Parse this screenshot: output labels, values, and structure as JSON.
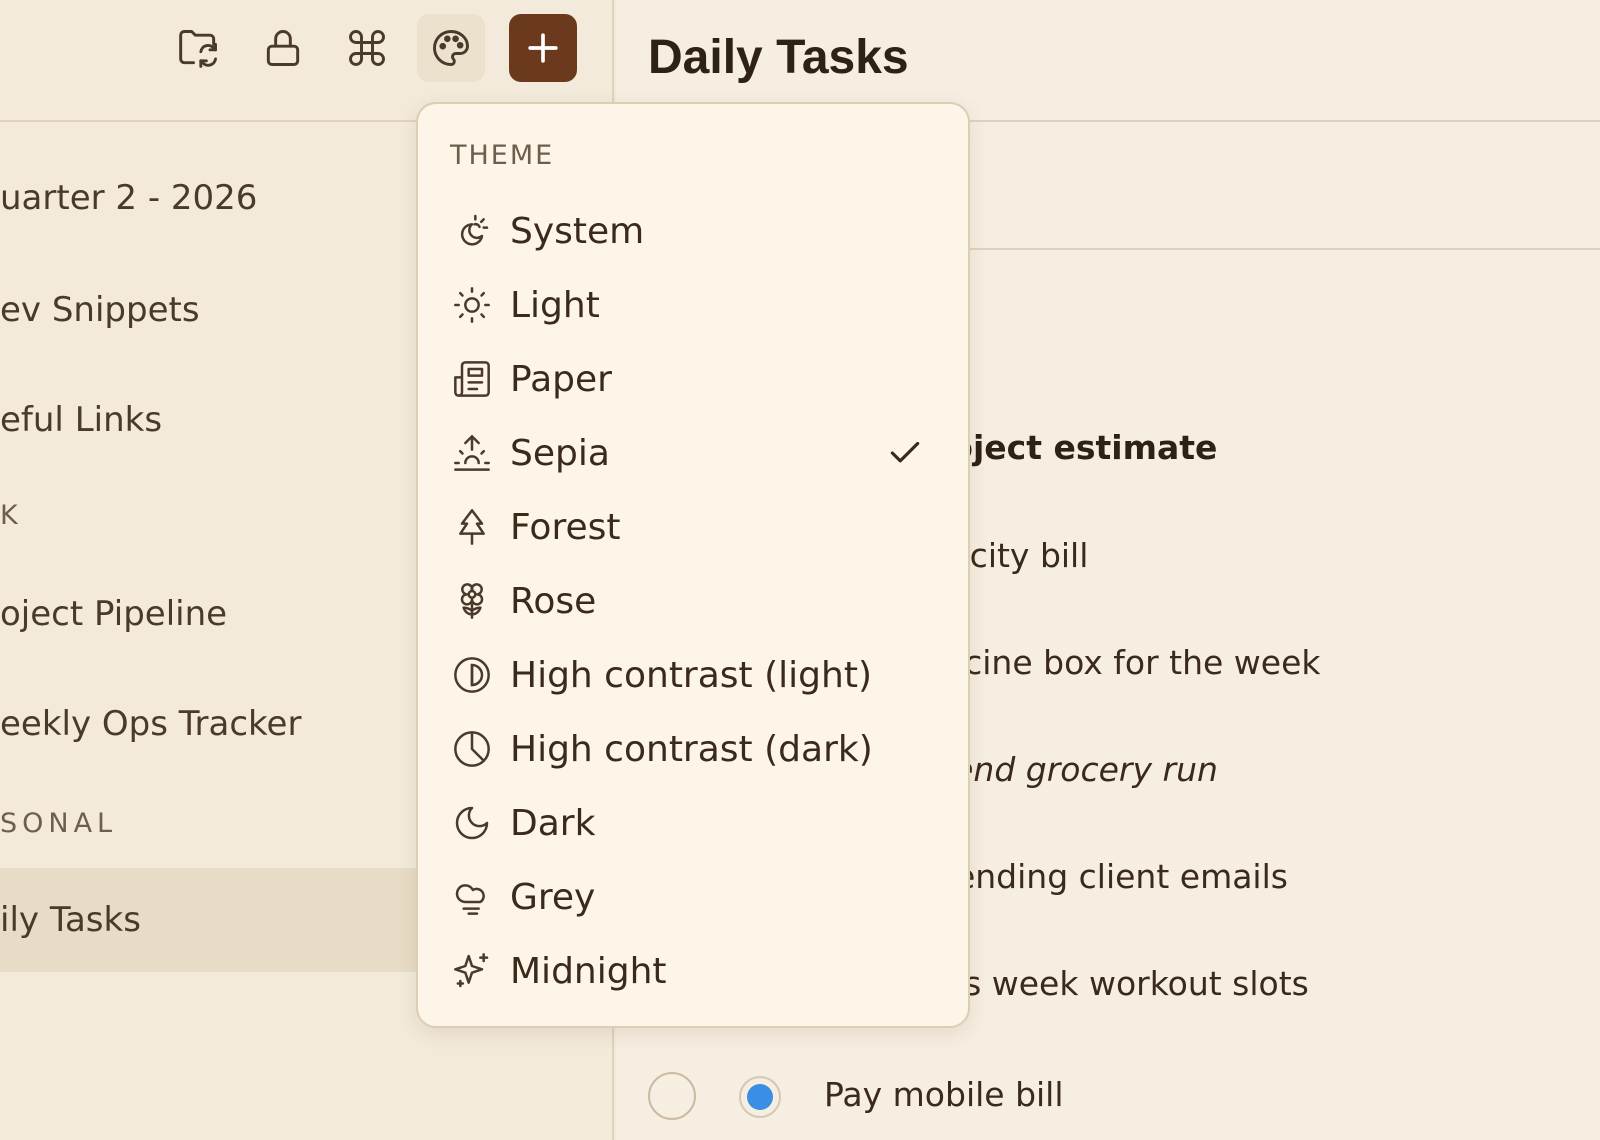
{
  "sidebar": {
    "items": [
      {
        "label": "uarter 2 - 2026"
      },
      {
        "label": "ev Snippets"
      },
      {
        "label": "eful Links"
      },
      {
        "label": "oject Pipeline"
      },
      {
        "label": "eekly Ops Tracker"
      },
      {
        "label": "ily Tasks"
      }
    ],
    "sections": [
      {
        "label": "K"
      },
      {
        "label": "SONAL"
      }
    ]
  },
  "toolbar": {
    "icons": [
      "folder-sync-icon",
      "lock-icon",
      "command-icon",
      "palette-icon",
      "plus-icon"
    ]
  },
  "main": {
    "title": "Daily Tasks",
    "tasks": [
      {
        "text": "roject estimate"
      },
      {
        "text": "tricity bill"
      },
      {
        "text": "dicine box for the week"
      },
      {
        "text": "kend grocery run"
      },
      {
        "text": "pending client emails"
      },
      {
        "text": "his week workout slots"
      },
      {
        "text": "Pay mobile bill"
      }
    ]
  },
  "theme_menu": {
    "header": "THEME",
    "selected": "Sepia",
    "options": [
      {
        "label": "System",
        "icon": "system-theme-icon"
      },
      {
        "label": "Light",
        "icon": "sun-icon"
      },
      {
        "label": "Paper",
        "icon": "newspaper-icon"
      },
      {
        "label": "Sepia",
        "icon": "sunrise-icon"
      },
      {
        "label": "Forest",
        "icon": "tree-icon"
      },
      {
        "label": "Rose",
        "icon": "flower-icon"
      },
      {
        "label": "High contrast (light)",
        "icon": "contrast-light-icon"
      },
      {
        "label": "High contrast (dark)",
        "icon": "contrast-dark-icon"
      },
      {
        "label": "Dark",
        "icon": "moon-icon"
      },
      {
        "label": "Grey",
        "icon": "cloud-icon"
      },
      {
        "label": "Midnight",
        "icon": "sparkles-icon"
      }
    ]
  },
  "colors": {
    "background": "#f3eadb",
    "accent": "#6b3a1d",
    "menu_bg": "#fdf5e8",
    "radio_selected": "#3a8ee6"
  }
}
